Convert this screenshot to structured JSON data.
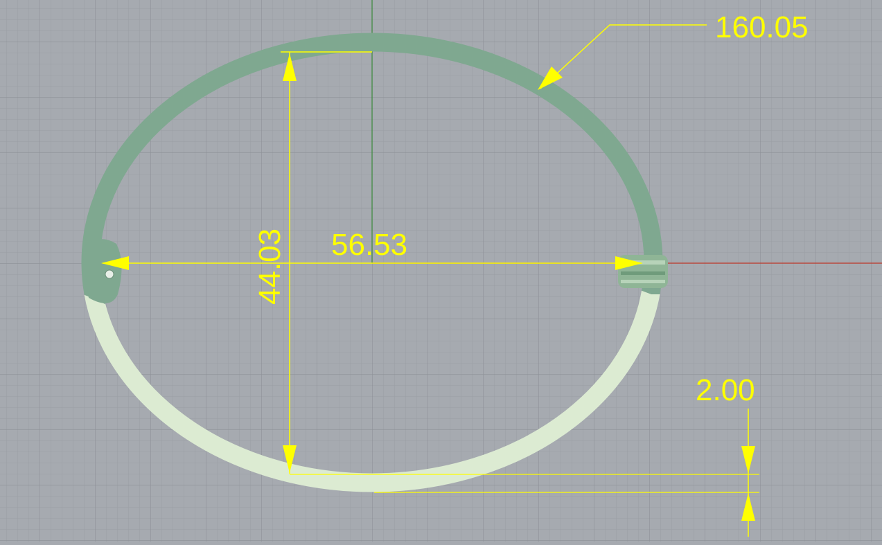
{
  "viewport": {
    "background": "#a6aab0",
    "grid_minor_color": "#9a9ea4",
    "grid_major_color": "#8d9197",
    "x_axis_color": "#c0392b",
    "y_axis_color": "#3a8a3a"
  },
  "model": {
    "ring_upper_color": "#7fa890",
    "ring_lower_color": "#dcebd2",
    "hinge_color": "#8fb596"
  },
  "dimensions": {
    "color": "#ffff00",
    "circumference": "160.05",
    "width": "56.53",
    "height": "44.03",
    "thickness": "2.00"
  }
}
